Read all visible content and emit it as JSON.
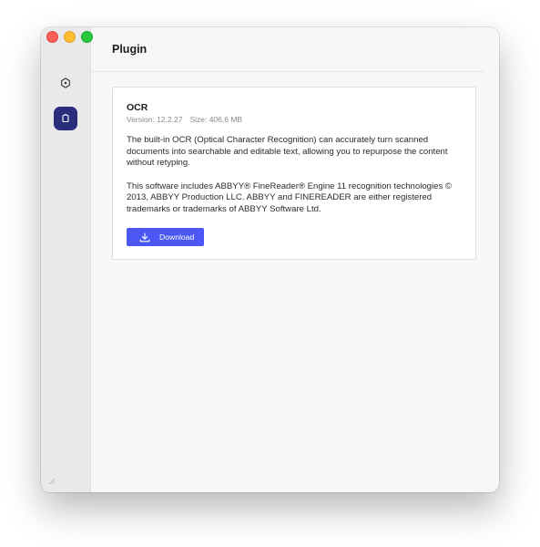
{
  "window": {
    "traffic_lights": [
      "close",
      "minimize",
      "maximize"
    ]
  },
  "sidebar": {
    "items": [
      {
        "name": "general",
        "icon": "hexagon-gear-icon",
        "active": false
      },
      {
        "name": "plugin",
        "icon": "plugin-icon",
        "active": true
      }
    ],
    "active_color": "#2a2e7a"
  },
  "header": {
    "title": "Plugin"
  },
  "plugin": {
    "name": "OCR",
    "version": "Version: 12.2.27",
    "size": "Size: 406,6 MB",
    "description": "The built-in OCR (Optical Character Recognition) can accurately turn scanned documents into searchable and editable text, allowing you to repurpose the content without retyping.",
    "license": "This software includes ABBYY® FineReader® Engine 11 recognition technologies © 2013, ABBYY Production LLC. ABBYY and FINEREADER are either registered trademarks or trademarks of ABBYY Software Ltd.",
    "download_label": "Download",
    "download_icon": "download-icon",
    "accent_color": "#4a57f5"
  }
}
